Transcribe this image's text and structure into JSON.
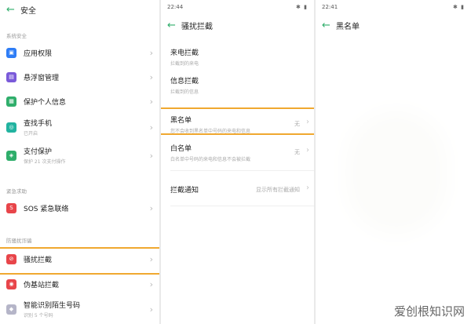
{
  "panel1": {
    "title": "安全",
    "section_system": "系统安全",
    "section_emergency": "紧急求助",
    "section_fraud": "防骚扰诈骗",
    "items": [
      {
        "label": "应用权限",
        "sub": "",
        "color": "#2e7df6",
        "glyph": "▣"
      },
      {
        "label": "悬浮窗管理",
        "sub": "",
        "color": "#7a5ad9",
        "glyph": "▤"
      },
      {
        "label": "保护个人信息",
        "sub": "",
        "color": "#2fae6b",
        "glyph": "▦"
      },
      {
        "label": "查找手机",
        "sub": "已开启",
        "color": "#22b3a0",
        "glyph": "◎"
      },
      {
        "label": "支付保护",
        "sub": "保护 21 次支付操作",
        "color": "#2fae6b",
        "glyph": "◈"
      },
      {
        "label": "SOS 紧急联络",
        "sub": "",
        "color": "#e8454a",
        "glyph": "S"
      },
      {
        "label": "骚扰拦截",
        "sub": "",
        "color": "#e8454a",
        "glyph": "⊘"
      },
      {
        "label": "伪基站拦截",
        "sub": "",
        "color": "#e8454a",
        "glyph": "◉"
      },
      {
        "label": "智能识别陌生号码",
        "sub": "识别 5 个号码",
        "color": "#b5b5c8",
        "glyph": "◆"
      }
    ]
  },
  "panel2": {
    "time": "22:44",
    "title": "骚扰拦截",
    "items": [
      {
        "title": "来电拦截",
        "sub": "拦截到的来电",
        "value": ""
      },
      {
        "title": "信息拦截",
        "sub": "拦截到的信息",
        "value": ""
      },
      {
        "title": "黑名单",
        "sub": "您不会收到黑名单中号码的来电和信息",
        "value": "无"
      },
      {
        "title": "白名单",
        "sub": "白名单中号码的来电和信息不会被拦截",
        "value": "无"
      },
      {
        "title": "拦截通知",
        "sub": "",
        "value": "显示所有拦截通知"
      }
    ]
  },
  "panel3": {
    "time": "22:41",
    "title": "黑名单"
  },
  "watermark": "爱创根知识网"
}
